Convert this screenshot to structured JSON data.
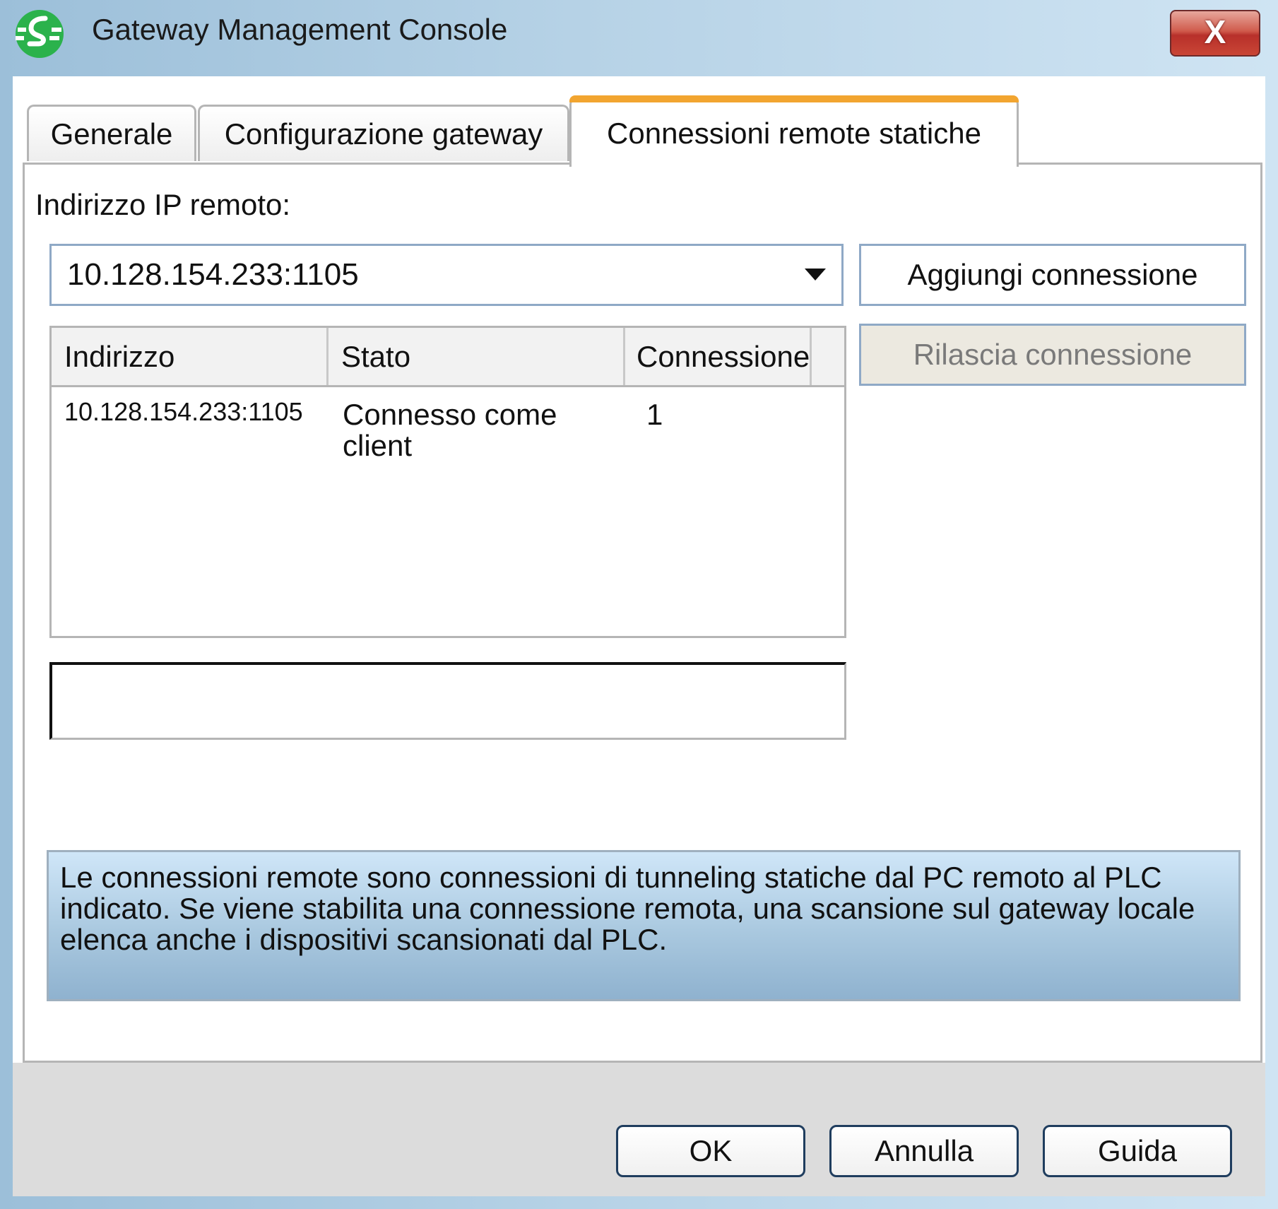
{
  "window": {
    "title": "Gateway Management Console",
    "close_label": "X"
  },
  "tabs": [
    {
      "label": "Generale",
      "active": false
    },
    {
      "label": "Configurazione gateway",
      "active": false
    },
    {
      "label": "Connessioni remote statiche",
      "active": true
    }
  ],
  "form": {
    "ip_label": "Indirizzo IP remoto:",
    "ip_value": "10.128.154.233:1105"
  },
  "buttons": {
    "add": "Aggiungi connessione",
    "release": "Rilascia connessione",
    "release_enabled": false
  },
  "table": {
    "columns": [
      "Indirizzo",
      "Stato",
      "Connessione"
    ],
    "rows": [
      {
        "address": "10.128.154.233:1105",
        "status_line1": "Connesso come",
        "status_line2": "client",
        "connection": "1"
      }
    ]
  },
  "status_box_text": "",
  "info_text": "Le connessioni remote sono connessioni di tunneling statiche dal PC remoto al PLC indicato. Se viene stabilita una connessione remota, una scansione sul gateway locale elenca anche i dispositivi scansionati dal PLC.",
  "footer": {
    "ok": "OK",
    "cancel": "Annulla",
    "help": "Guida"
  },
  "colors": {
    "titlebar": "#b6d2e6",
    "logo_green": "#2bb24c",
    "active_tab_accent": "#f2a530",
    "close_red": "#c94636"
  },
  "icons": {
    "app_logo": "app-logo-icon",
    "dropdown": "chevron-down-icon"
  }
}
